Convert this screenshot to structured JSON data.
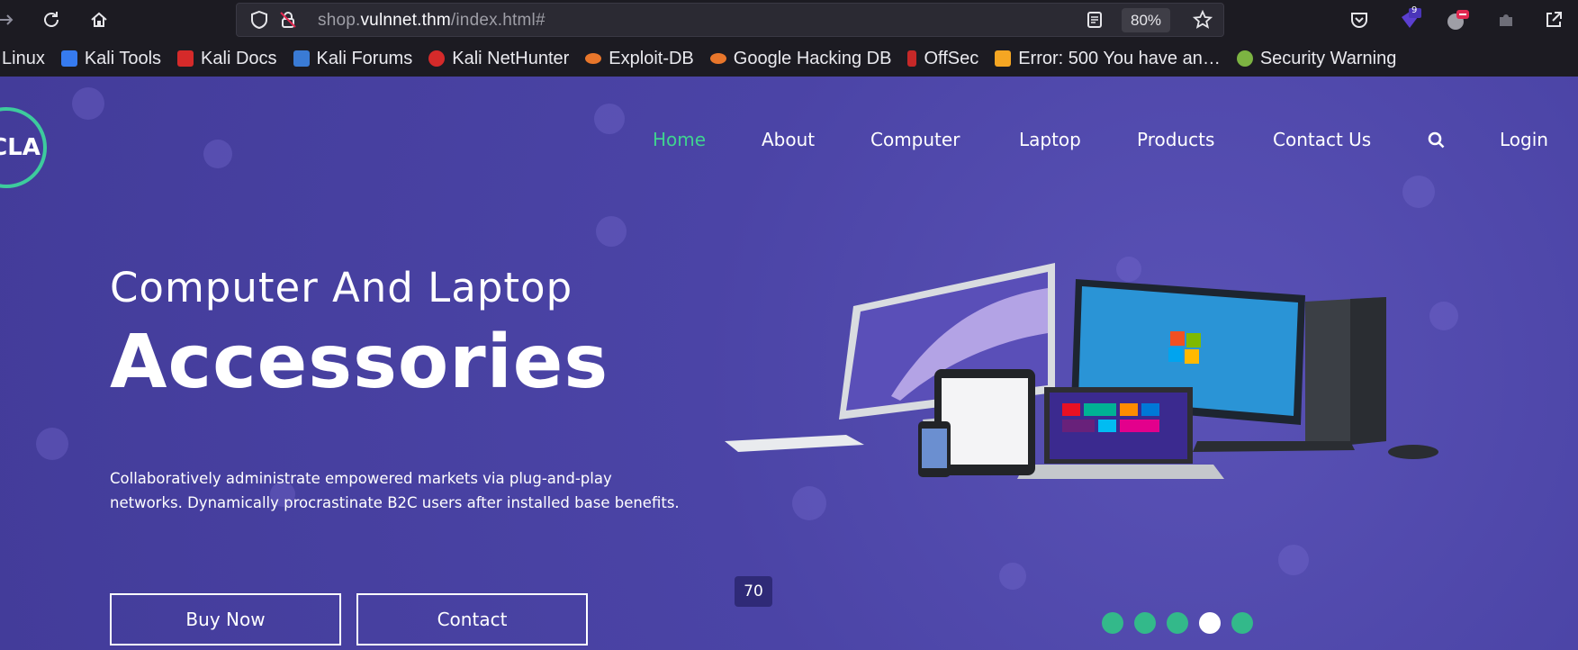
{
  "browser": {
    "url_prefix": "shop.",
    "url_host": "vulnnet.thm",
    "url_path": "/index.html#",
    "zoom": "80%",
    "extension_badge": "9"
  },
  "bookmarks": [
    {
      "label": "Linux",
      "color": ""
    },
    {
      "label": "Kali Tools",
      "color": "#367bf0"
    },
    {
      "label": "Kali Docs",
      "color": "#d52a2a"
    },
    {
      "label": "Kali Forums",
      "color": "#3a7bd5"
    },
    {
      "label": "Kali NetHunter",
      "color": "#d52a2a"
    },
    {
      "label": "Exploit-DB",
      "color": "#e8762b"
    },
    {
      "label": "Google Hacking DB",
      "color": "#e8762b"
    },
    {
      "label": "OffSec",
      "color": "#c62828"
    },
    {
      "label": "Error: 500 You have an…",
      "color": "#f5a623"
    },
    {
      "label": "Security Warning",
      "color": "#7cb342"
    }
  ],
  "site": {
    "logo_text": "CLA",
    "nav": [
      "Home",
      "About",
      "Computer",
      "Laptop",
      "Products",
      "Contact Us",
      "Login"
    ],
    "hero_subtitle": "Computer And Laptop",
    "hero_title": "Accessories",
    "hero_description": "Collaboratively administrate empowered markets via plug-and-play networks. Dynamically procrastinate B2C users after installed base benefits.",
    "buy_button": "Buy Now",
    "contact_button": "Contact",
    "tooltip": "70",
    "carousel_active_index": 3,
    "carousel_count": 5,
    "accent_color": "#3fd38f"
  }
}
